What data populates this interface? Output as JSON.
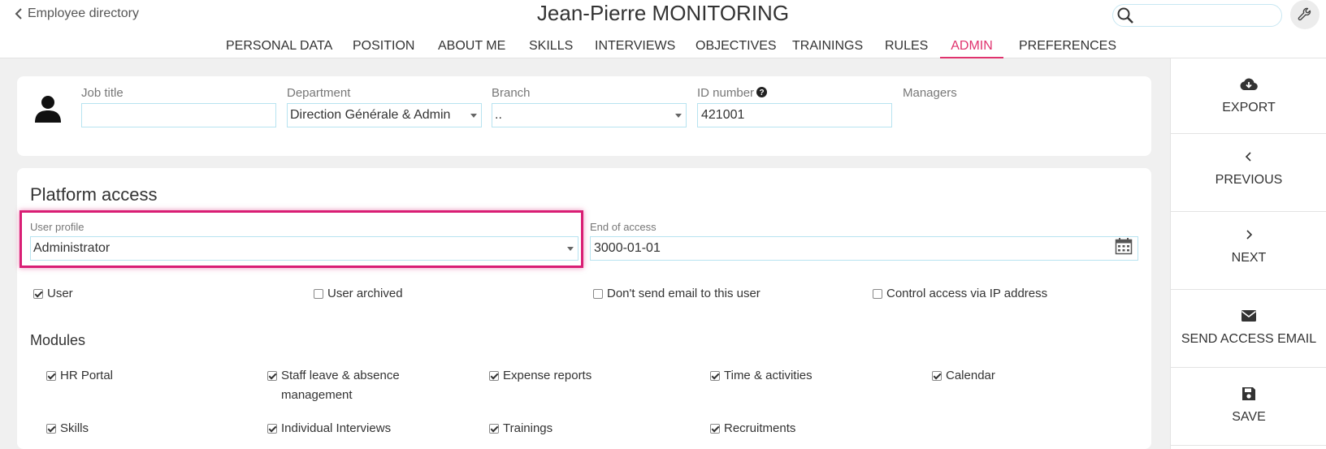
{
  "header": {
    "back_label": "Employee directory",
    "title": "Jean-Pierre MONITORING",
    "search_placeholder": ""
  },
  "tabs": [
    {
      "label": "PERSONAL DATA"
    },
    {
      "label": "POSITION"
    },
    {
      "label": "ABOUT ME"
    },
    {
      "label": "SKILLS"
    },
    {
      "label": "INTERVIEWS"
    },
    {
      "label": "OBJECTIVES"
    },
    {
      "label": "TRAININGS"
    },
    {
      "label": "RULES"
    },
    {
      "label": "ADMIN",
      "active": true
    },
    {
      "label": "PREFERENCES"
    }
  ],
  "colors": {
    "accent": "#e0336e",
    "highlight_border": "#d91e74",
    "input_border": "#b7e3f0"
  },
  "position_card": {
    "job_title": {
      "label": "Job title",
      "value": ""
    },
    "department": {
      "label": "Department",
      "value": "Direction Générale & Admin"
    },
    "branch": {
      "label": "Branch",
      "value": ".."
    },
    "id_number": {
      "label": "ID number",
      "value": "421001",
      "help_icon": "question-circle-icon"
    },
    "managers": {
      "label": "Managers"
    }
  },
  "platform_access": {
    "title": "Platform access",
    "user_profile": {
      "label": "User profile",
      "value": "Administrator"
    },
    "end_of_access": {
      "label": "End of access",
      "value": "3000-01-01",
      "icon": "calendar-icon"
    },
    "flags": [
      {
        "label": "User",
        "checked": true
      },
      {
        "label": "User archived",
        "checked": false
      },
      {
        "label": "Don't send email to this user",
        "checked": false
      },
      {
        "label": "Control access via IP address",
        "checked": false
      }
    ]
  },
  "modules": {
    "title": "Modules",
    "items": [
      {
        "label": "HR Portal",
        "checked": true
      },
      {
        "label": "Staff leave & absence management",
        "checked": true
      },
      {
        "label": "Expense reports",
        "checked": true
      },
      {
        "label": "Time & activities",
        "checked": true
      },
      {
        "label": "Calendar",
        "checked": true
      },
      {
        "label": "Skills",
        "checked": true
      },
      {
        "label": "Individual Interviews",
        "checked": true
      },
      {
        "label": "Trainings",
        "checked": true
      },
      {
        "label": "Recruitments",
        "checked": true
      }
    ]
  },
  "actions": [
    {
      "label": "EXPORT",
      "icon": "cloud-download-icon"
    },
    {
      "label": "PREVIOUS",
      "icon": "chevron-left-icon"
    },
    {
      "label": "NEXT",
      "icon": "chevron-right-icon"
    },
    {
      "label": "SEND ACCESS EMAIL",
      "icon": "envelope-icon"
    },
    {
      "label": "SAVE",
      "icon": "floppy-disk-icon"
    }
  ]
}
